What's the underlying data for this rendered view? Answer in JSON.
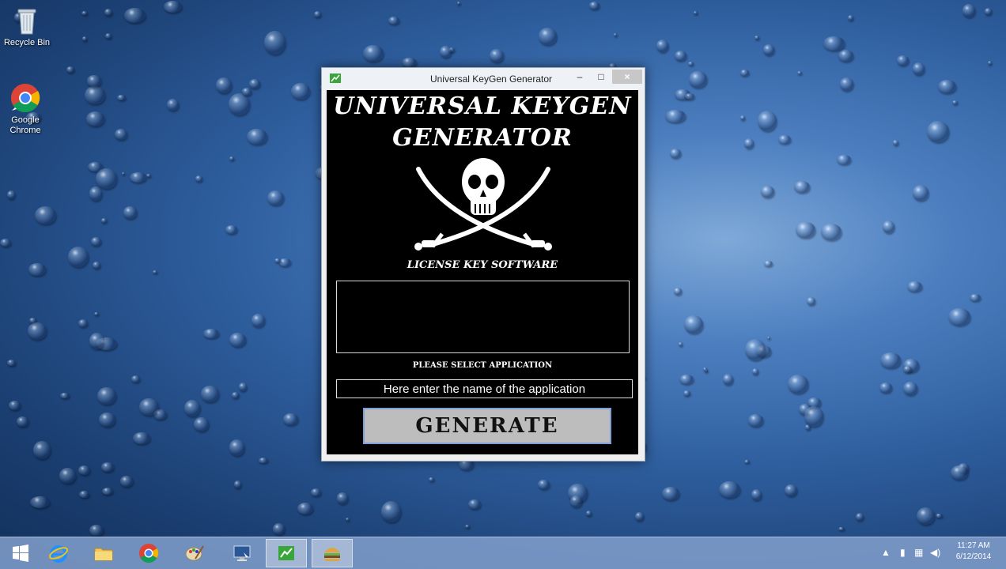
{
  "desktop": {
    "icons": [
      {
        "label": "Recycle Bin"
      },
      {
        "label": "Google Chrome"
      }
    ]
  },
  "window": {
    "title": "Universal KeyGen Generator",
    "controls": {
      "minimize": "–",
      "maximize": "□",
      "close": "×"
    },
    "headline_line1": "UNIVERSAL KEYGEN",
    "headline_line2": "GENERATOR",
    "tagline": "LICENSE KEY SOFTWARE",
    "select_label": "PLEASE SELECT APPLICATION",
    "app_input_placeholder": "Here enter the name of the application",
    "generate_label": "GENERATE"
  },
  "taskbar": {
    "items": [
      "start",
      "internet-explorer",
      "file-explorer",
      "chrome",
      "paint",
      "remote-desktop",
      "keygen-app",
      "burger-app"
    ],
    "clock_time": "11:27 AM",
    "clock_date": "6/12/2014"
  },
  "colors": {
    "window_client": "#000000",
    "generate_button": "#bdbdbd",
    "taskbar": "#82a0cd"
  }
}
